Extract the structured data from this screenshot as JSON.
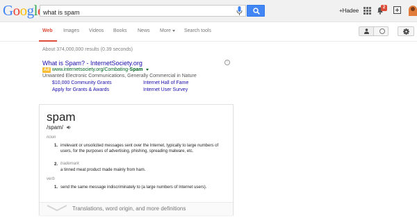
{
  "header": {
    "logo_letters": [
      "G",
      "o",
      "o",
      "g",
      "l",
      "e"
    ],
    "search_value": "what is spam",
    "user_name": "+Hadee",
    "notification_count": "2"
  },
  "nav": {
    "tabs": [
      "Web",
      "Images",
      "Videos",
      "Books",
      "News",
      "More",
      "Search tools"
    ],
    "active_tab": "Web"
  },
  "results": {
    "stats": "About 374,000,000 results (0.39 seconds)",
    "ad": {
      "title": "What is Spam? - InternetSociety.org",
      "badge": "Ad",
      "url_prefix": "www.internetsociety.org/Combating-",
      "url_bold": "Spam",
      "description": "Unwanted Electronic Communications, Generally Commercial in Nature",
      "sitelinks": [
        "$10,000 Community Grants",
        "Internet Hall of Fame",
        "Apply for Grants & Awards",
        "Internet User Survey"
      ]
    }
  },
  "dictionary": {
    "word": "spam",
    "phonetic": "/spam/",
    "sections": [
      {
        "pos": "noun",
        "defs": [
          {
            "num": "1.",
            "tag": "",
            "text": "irrelevant or unsolicited messages sent over the Internet, typically to large numbers of users, for the purposes of advertising, phishing, spreading malware, etc."
          },
          {
            "num": "2.",
            "tag": "trademark",
            "text": "a tinned meat product made mainly from ham."
          }
        ]
      },
      {
        "pos": "verb",
        "defs": [
          {
            "num": "1.",
            "tag": "",
            "text": "send the same message indiscriminately to (a large numbers of Internet users)."
          }
        ]
      }
    ],
    "more_link": "Translations, word origin, and more definitions"
  },
  "colors": {
    "accent": "#dd4b39",
    "link": "#1a0dab",
    "url_green": "#006621",
    "search_blue": "#4285f4"
  }
}
